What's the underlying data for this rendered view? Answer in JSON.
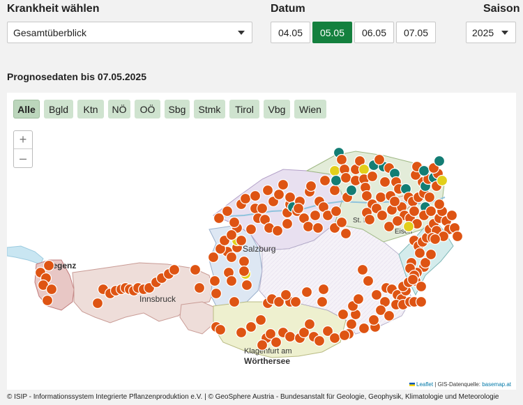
{
  "filters": {
    "disease_label": "Krankheit wählen",
    "disease_value": "Gesamtüberblick",
    "date_label": "Datum",
    "dates": [
      "04.05",
      "05.05",
      "06.05",
      "07.05"
    ],
    "active_date": "05.05",
    "season_label": "Saison",
    "season_value": "2025"
  },
  "forecast_title": "Prognosedaten bis 07.05.2025",
  "regions": [
    "Alle",
    "Bgld",
    "Ktn",
    "NÖ",
    "OÖ",
    "Sbg",
    "Stmk",
    "Tirol",
    "Vbg",
    "Wien"
  ],
  "active_region": "Alle",
  "zoom": {
    "in": "+",
    "out": "–"
  },
  "map_labels": {
    "bregenz": "Bregenz",
    "innsbruck": "Innsbruck",
    "salzburg": "Salzburg",
    "klagenfurt": "Klagenfurt am",
    "woerthersee": "Wörthersee",
    "eisenstadt": "Eisen",
    "st_poelten": "St. Pö"
  },
  "attribution": {
    "leaflet": "Leaflet",
    "source_prefix": "| GIS-Datenquelle:",
    "source_link": "basemap.at"
  },
  "footer": "© ISIP - Informationssystem Integrierte Pflanzenproduktion e.V. | © GeoSphere Austria - Bundesanstalt für Geologie, Geophysik, Klimatologie und Meteorologie",
  "marker_colors": {
    "orange": "#de5413",
    "teal": "#137d74",
    "yellow": "#e2cf1b"
  }
}
